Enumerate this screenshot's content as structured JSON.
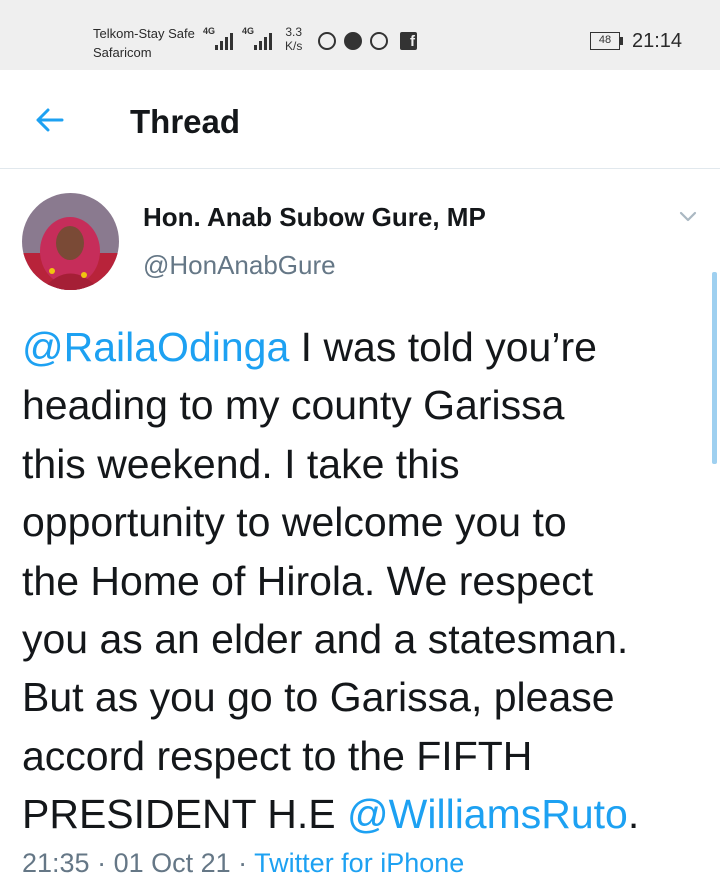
{
  "status_bar": {
    "carrier_1": "Telkom-Stay Safe",
    "carrier_2": "Safaricom",
    "network_1": "4G",
    "network_2": "4G",
    "speed_value": "3.3",
    "speed_unit": "K/s",
    "notification_icons": [
      "whatsapp-icon",
      "messenger-icon",
      "hand-stop-icon",
      "facebook-icon"
    ],
    "battery": "48",
    "time": "21:14"
  },
  "header": {
    "back_icon": "arrow-left-icon",
    "title": "Thread"
  },
  "tweet": {
    "author_name": "Hon. Anab Subow Gure, MP",
    "author_handle": "@HonAnabGure",
    "menu_icon": "chevron-down-icon",
    "mention_1": "@RailaOdinga",
    "text_1": " I was told you’re\nheading to my county Garissa\nthis weekend. I take this\nopportunity to welcome you to\nthe Home of Hirola. We respect\nyou as an elder and a statesman.\nBut as you go to Garissa, please\naccord respect to the FIFTH\nPRESIDENT H.E ",
    "mention_2": "@WilliamsRuto",
    "text_2": ".",
    "time": "21:35",
    "separator": " · ",
    "date": "01 Oct 21",
    "source": "Twitter for iPhone"
  },
  "colors": {
    "accent": "#1da1f2",
    "secondary_text": "#657786",
    "primary_text": "#14171a",
    "status_bar_bg": "#efefef"
  }
}
